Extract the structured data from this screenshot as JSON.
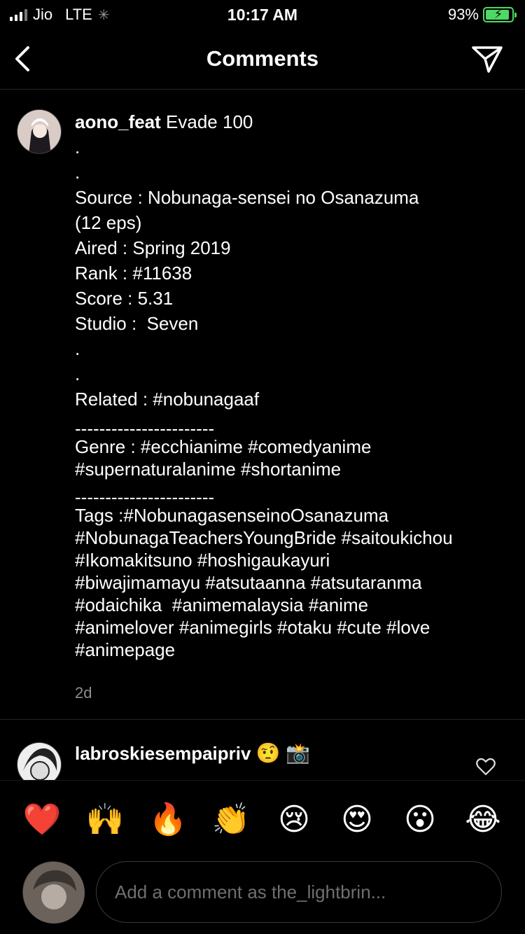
{
  "status_bar": {
    "carrier": "Jio",
    "network": "LTE",
    "time": "10:17 AM",
    "battery_percent": "93%",
    "battery_level": 0.93
  },
  "header": {
    "title": "Comments",
    "back_icon": "chevron-left-icon",
    "send_icon": "paper-plane-icon"
  },
  "comments": [
    {
      "username": "aono_feat",
      "text_first": "Evade 100",
      "lines": [
        ".",
        ".",
        "Source : Nobunaga-sensei no Osanazuma",
        "(12 eps)",
        "Aired : Spring 2019",
        "Rank : #11638",
        "Score : 5.31",
        "Studio :  Seven",
        ".",
        ".",
        "Related : #nobunagaaf"
      ],
      "separator": "-----------------------",
      "genre_lines": [
        "Genre : #ecchianime #comedyanime",
        "#supernaturalanime #shortanime"
      ],
      "separator2": "-----------------------",
      "tag_lines": [
        "Tags :#NobunagasenseinoOsanazuma",
        "#NobunagaTeachersYoungBride #saitoukichou",
        "#Ikomakitsuno #hoshigaukayuri",
        "#biwajimamayu #atsutaanna #atsutaranma",
        "#odaichika  #animemalaysia #anime",
        "#animelover #animegirls #otaku #cute #love",
        "#animepage"
      ],
      "time": "2d"
    },
    {
      "username": "labroskiesempaipriv",
      "emojis": "🤨 📸"
    }
  ],
  "reactions": [
    "❤️",
    "🙌",
    "🔥",
    "👏",
    "😢",
    "😍",
    "😮",
    "😂"
  ],
  "composer": {
    "placeholder": "Add a comment as the_lightbrin..."
  },
  "colors": {
    "background": "#000000",
    "secondary_text": "#8e8e8e",
    "battery": "#4cd964"
  }
}
